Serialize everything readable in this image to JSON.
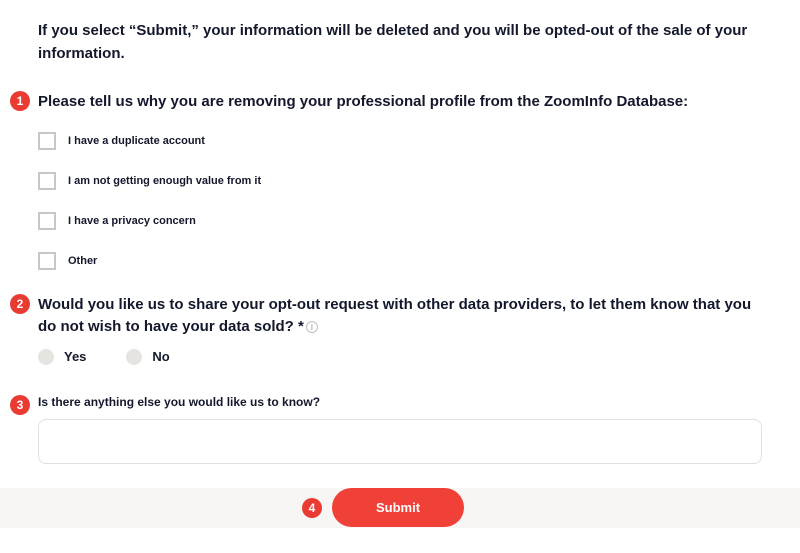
{
  "intro": "If you select “Submit,” your information will be deleted and you will be opted-out of the sale of your information.",
  "q1": {
    "num": "1",
    "title": "Please tell us why you are removing your professional profile from the ZoomInfo Database:",
    "options": [
      "I have a duplicate account",
      "I am not getting enough value from it",
      "I have a privacy concern",
      "Other"
    ]
  },
  "q2": {
    "num": "2",
    "title": "Would you like us to share your opt-out request with other data providers, to let them know that you do not wish to have your data sold? *",
    "yes": "Yes",
    "no": "No"
  },
  "q3": {
    "num": "3",
    "title": "Is there anything else you would like us to know?"
  },
  "submit": {
    "num": "4",
    "label": "Submit"
  }
}
